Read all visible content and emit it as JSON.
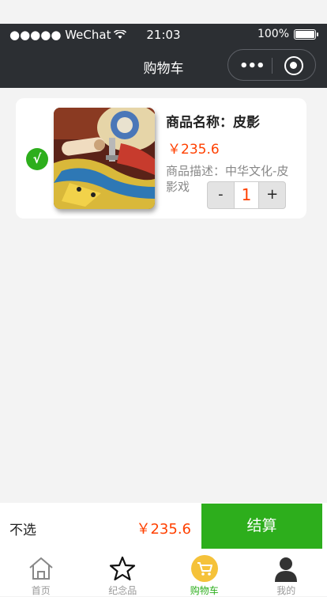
{
  "status_bar": {
    "carrier": "●●●●● WeChat",
    "time": "21:03",
    "battery": "100%"
  },
  "nav": {
    "title": "购物车",
    "more_icon": "more-dots-icon",
    "close_icon": "target-circle-icon"
  },
  "cart": {
    "items": [
      {
        "selected": true,
        "name": "商品名称：皮影",
        "price": "￥235.6",
        "description": "商品描述：中华文化-皮影戏",
        "quantity": "1",
        "minus": "-",
        "plus": "+"
      }
    ]
  },
  "checkout": {
    "deselect_label": "不选",
    "total": "￥235.6",
    "settle_label": "结算"
  },
  "tabs": [
    {
      "label": "首页",
      "icon": "home-icon",
      "active": false
    },
    {
      "label": "纪念品",
      "icon": "star-icon",
      "active": false
    },
    {
      "label": "购物车",
      "icon": "cart-icon",
      "active": true
    },
    {
      "label": "我的",
      "icon": "user-icon",
      "active": false
    }
  ],
  "colors": {
    "accent_green": "#2dae1c",
    "price_orange": "#ff4000",
    "nav_dark": "#2c2f33",
    "cart_tab_yellow": "#f5c23a"
  }
}
